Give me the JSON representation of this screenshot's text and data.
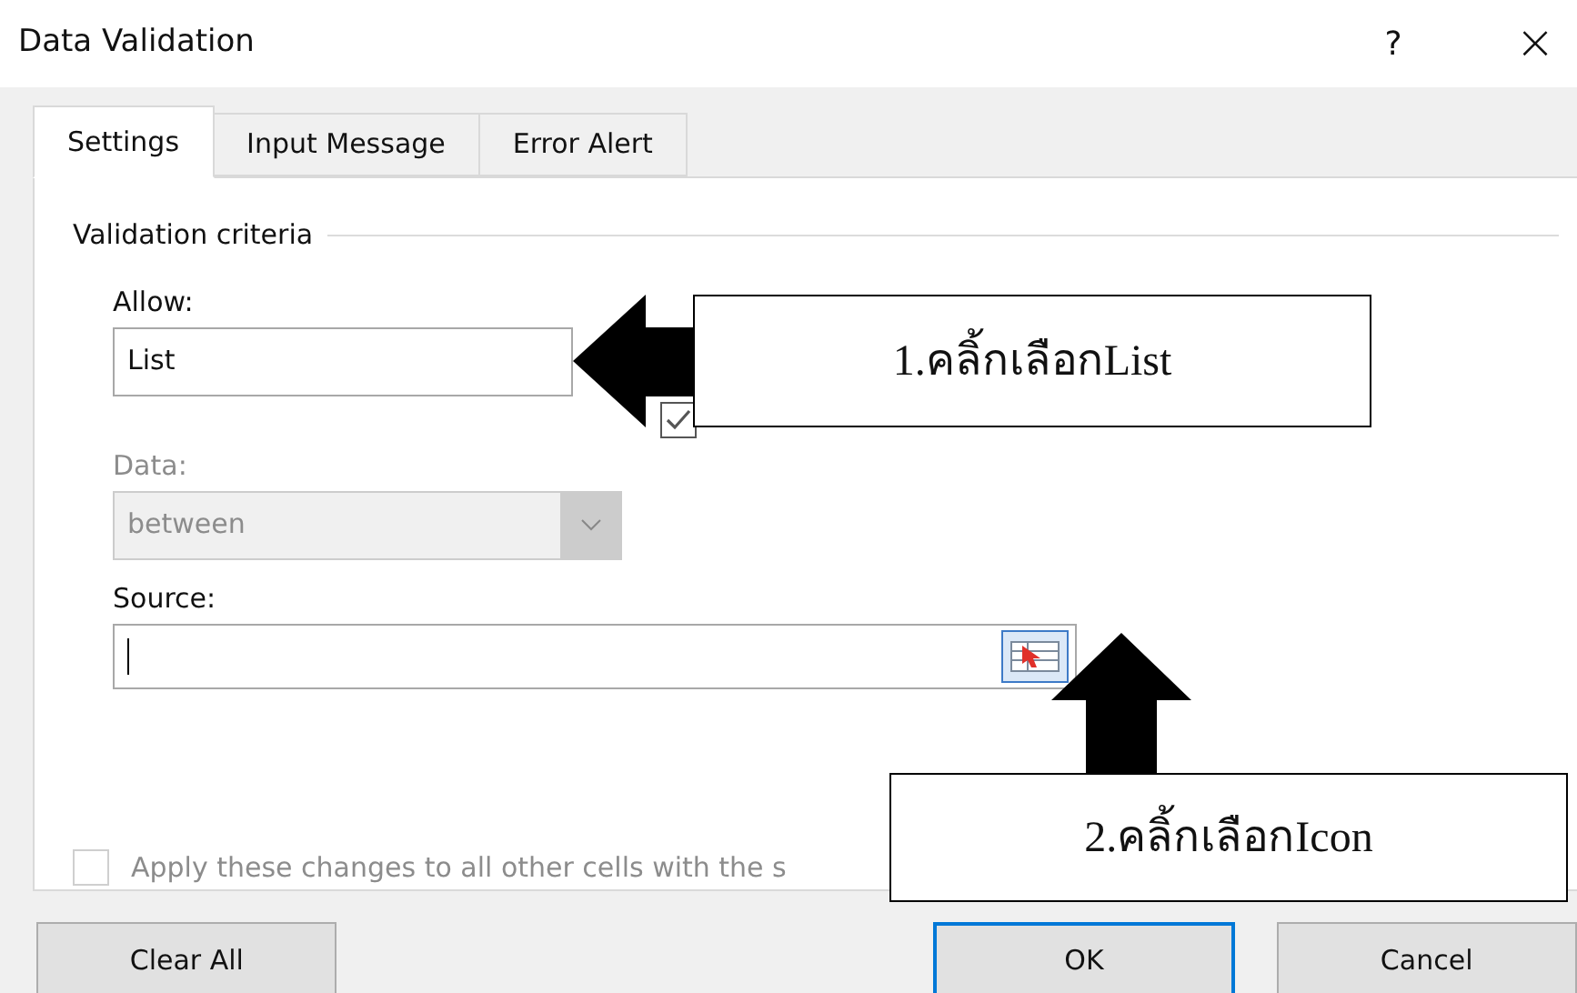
{
  "dialog": {
    "title": "Data Validation",
    "help": "?",
    "close": "×"
  },
  "tabs": [
    {
      "label": "Settings",
      "selected": true
    },
    {
      "label": "Input Message",
      "selected": false
    },
    {
      "label": "Error Alert",
      "selected": false
    }
  ],
  "group": {
    "title": "Validation criteria"
  },
  "allow": {
    "label": "Allow:",
    "value": "List"
  },
  "data": {
    "label": "Data:",
    "value": "between",
    "disabled": true
  },
  "in_cell_dropdown": {
    "checked": true
  },
  "source": {
    "label": "Source:"
  },
  "apply_all": {
    "label": "Apply these changes to all other cells with the s",
    "checked": false,
    "disabled": true
  },
  "buttons": [
    {
      "label": "Clear All",
      "default": false
    },
    {
      "label": "OK",
      "default": true
    },
    {
      "label": "Cancel",
      "default": false
    }
  ],
  "callouts": [
    {
      "text": "1.คลิ้กเลือกList"
    },
    {
      "text": "2.คลิ้กเลือกIcon"
    }
  ]
}
